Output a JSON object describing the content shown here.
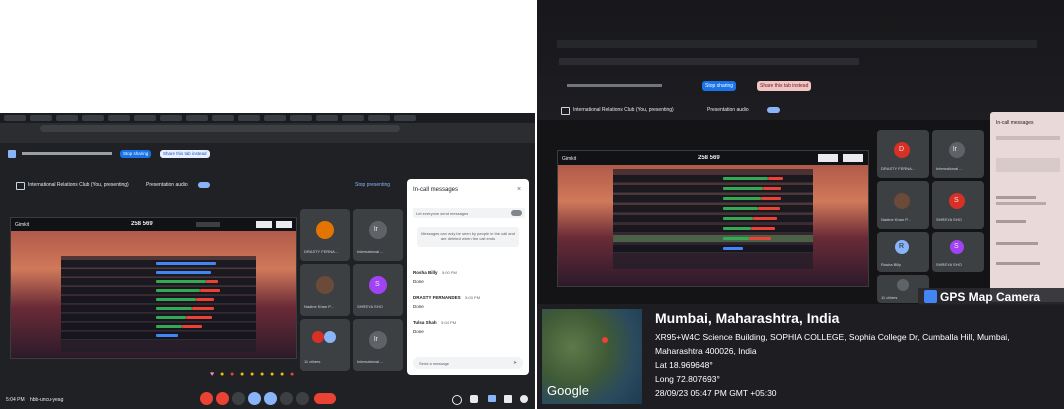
{
  "left_photo": {
    "meeting_bar": {
      "stop_sharing": "Stop sharing",
      "share_audio": "Share this tab instead"
    },
    "presentation": {
      "title": "International Relations Club (You, presenting)",
      "audio_label": "Presentation audio",
      "stop_presenting": "Stop presenting"
    },
    "stage": {
      "brand": "Gimkit",
      "score": "258 569"
    },
    "participants": [
      {
        "name": "DRASTY FERNA...",
        "color": "#e37400",
        "initial": ""
      },
      {
        "name": "International ...",
        "color": "#5f6368",
        "initial": "lr"
      },
      {
        "name": "Nadine Khan P...",
        "color": "#5f6368",
        "initial": ""
      },
      {
        "name": "SHREYA SHO",
        "color": "#a142f4",
        "initial": "S"
      },
      {
        "name": "11 others",
        "color": "#5f6368",
        "initial": ""
      },
      {
        "name": "International ...",
        "color": "#5f6368",
        "initial": "lr"
      }
    ],
    "chat": {
      "title": "In-call messages",
      "toggle_label": "Let everyone send messages",
      "notice": "Messages can only be seen by people in the call and are deleted when the call ends",
      "messages": [
        {
          "author": "Rosha Billy",
          "time": "5:00 PM",
          "text": "Done"
        },
        {
          "author": "DRASTY FERNANDES",
          "time": "5:03 PM",
          "text": "Done"
        },
        {
          "author": "Tulsa Shah",
          "time": "5:04 PM",
          "text": "Done"
        }
      ],
      "input_placeholder": "Send a message"
    },
    "footer": {
      "time": "5:04 PM",
      "meeting_code": "hbb-uncu-yeag"
    }
  },
  "right_photo": {
    "share_buttons": {
      "stop_sharing": "Stop sharing",
      "share_audio": "Share this tab instead"
    },
    "presentation": {
      "title": "International Relations Club (You, presenting)",
      "audio_label": "Presentation audio"
    },
    "stage": {
      "brand": "Gimkit",
      "score": "258 569"
    },
    "participants": [
      {
        "name": "DRASTY FERNA...",
        "color": "#d93025",
        "initial": "D"
      },
      {
        "name": "International ...",
        "color": "#5f6368",
        "initial": "lr"
      },
      {
        "name": "Nadine Khan P...",
        "color": "#5f6368",
        "initial": ""
      },
      {
        "name": "SHREYA SHO",
        "color": "#d93025",
        "initial": "S"
      },
      {
        "name": "Rosha Billy",
        "color": "#8ab4f8",
        "initial": "R"
      },
      {
        "name": "SHREYA SHO",
        "color": "#a142f4",
        "initial": "S"
      },
      {
        "name": "11 others",
        "color": "#5f6368",
        "initial": ""
      }
    ],
    "chat_title": "In-call messages",
    "gps": {
      "app_name": "GPS Map Camera",
      "map_brand": "Google",
      "city": "Mumbai, Maharashtra, India",
      "address_line1": "XR95+W4C Science Building, SOPHIA COLLEGE, Sophia College Dr, Cumballa Hill, Mumbai,",
      "address_line2": "Maharashtra 400026, India",
      "lat": "Lat 18.969648°",
      "long": "Long 72.807693°",
      "datetime": "28/09/23 05:47 PM GMT +05:30"
    }
  }
}
